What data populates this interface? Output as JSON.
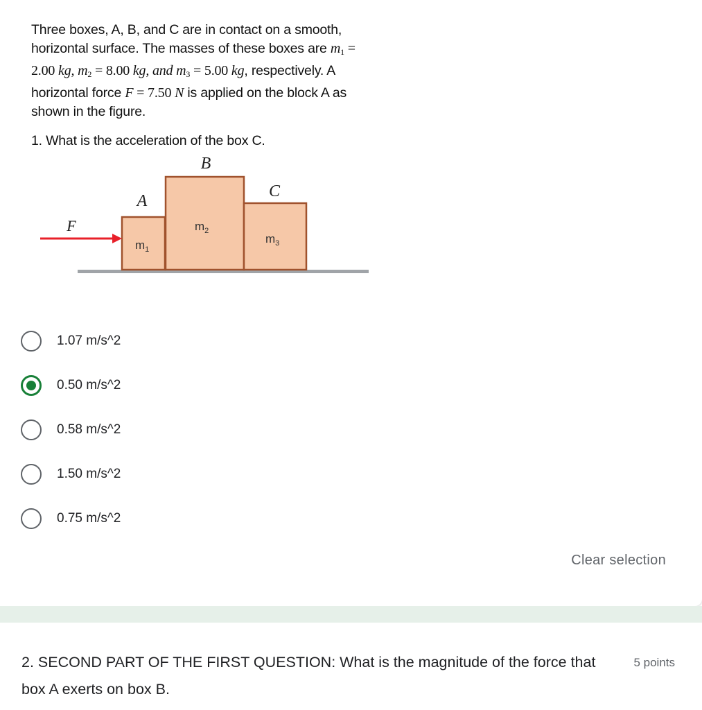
{
  "question1": {
    "problem_lines": {
      "line1": "Three boxes, A, B, and C are in contact on a smooth,",
      "line2_prefix": "horizontal surface. The masses of these boxes are ",
      "m1_symbol": "m",
      "m1_sub": "1",
      "equals": " =",
      "line3_m1_value": "2.00 ",
      "unit_kg": "kg",
      "sep1": ",  ",
      "m2_symbol": "m",
      "m2_sub": "2",
      "m2_value": " = 8.00 ",
      "unit_kg2": "kg",
      "sep2": ",  and ",
      "m3_symbol": "m",
      "m3_sub": "3",
      "m3_value": " = 5.00 ",
      "unit_kg3": "kg",
      "line3_suffix": ", respectively. A",
      "line4_prefix": "horizontal force ",
      "force_symbol": "F",
      "force_value": " = 7.50 ",
      "force_unit": "N",
      "line4_suffix": " is applied on the block A as",
      "line5": "shown in the figure."
    },
    "title": "1. What is the acceleration of the box C.",
    "figure": {
      "label_B": "B",
      "label_A": "A",
      "label_C": "C",
      "label_F": "F",
      "mass1": "m",
      "mass1_sub": "1",
      "mass2": "m",
      "mass2_sub": "2",
      "mass3": "m",
      "mass3_sub": "3",
      "box_fill": "#f6c8a8",
      "box_stroke": "#a0522d",
      "arrow_color": "#e8202a",
      "ground_color": "#a0a4a8"
    },
    "options": [
      {
        "label": "1.07 m/s^2",
        "selected": false
      },
      {
        "label": "0.50 m/s^2",
        "selected": true
      },
      {
        "label": "0.58 m/s^2",
        "selected": false
      },
      {
        "label": "1.50 m/s^2",
        "selected": false
      },
      {
        "label": "0.75 m/s^2",
        "selected": false
      }
    ],
    "clear_selection": "Clear selection"
  },
  "question2": {
    "text": "2. SECOND PART OF THE FIRST QUESTION: What is the magnitude of the force that box A exerts on box B.",
    "points": "5 points"
  },
  "colors": {
    "accent": "#188038",
    "band": "#e6f0e9",
    "muted": "#5f6368"
  }
}
